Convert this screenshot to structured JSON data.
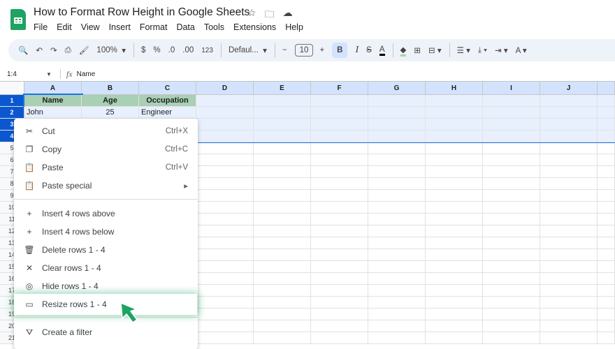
{
  "doc_title": "How to Format Row Height in Google Sheets",
  "menus": [
    "File",
    "Edit",
    "View",
    "Insert",
    "Format",
    "Data",
    "Tools",
    "Extensions",
    "Help"
  ],
  "toolbar": {
    "zoom": "100%",
    "currency": "$",
    "percent": "%",
    "dec_decrease": ".0",
    "dec_increase": ".00",
    "number_format": "123",
    "font": "Defaul...",
    "font_size": "10",
    "bold": "B",
    "italic": "I",
    "text_color": "A"
  },
  "name_box": "1:4",
  "formula_label": "fx",
  "formula": "Name",
  "columns": [
    "A",
    "B",
    "C",
    "D",
    "E",
    "F",
    "G",
    "H",
    "I",
    "J",
    ""
  ],
  "row_numbers": [
    "1",
    "2",
    "3",
    "4",
    "5",
    "6",
    "7",
    "8",
    "9",
    "10",
    "11",
    "12",
    "13",
    "14",
    "15",
    "16",
    "17",
    "18",
    "19",
    "20",
    "21"
  ],
  "cells": [
    [
      "Name",
      "Age",
      "Occupation"
    ],
    [
      "John",
      "25",
      "Engineer"
    ]
  ],
  "context_menu": [
    {
      "label": "Cut",
      "shortcut": "Ctrl+X",
      "icon": "✂",
      "name": "cut"
    },
    {
      "label": "Copy",
      "shortcut": "Ctrl+C",
      "icon": "❐",
      "name": "copy"
    },
    {
      "label": "Paste",
      "shortcut": "Ctrl+V",
      "icon": "📋",
      "name": "paste"
    },
    {
      "label": "Paste special",
      "shortcut": "▸",
      "icon": "📋",
      "name": "paste-special"
    },
    {
      "label": "Insert 4 rows above",
      "shortcut": "",
      "icon": "+",
      "name": "insert-rows-above"
    },
    {
      "label": "Insert 4 rows below",
      "shortcut": "",
      "icon": "+",
      "name": "insert-rows-below"
    },
    {
      "label": "Delete rows 1 - 4",
      "shortcut": "",
      "icon": "🗑",
      "name": "delete-rows"
    },
    {
      "label": "Clear rows 1 - 4",
      "shortcut": "",
      "icon": "✕",
      "name": "clear-rows"
    },
    {
      "label": "Hide rows 1 - 4",
      "shortcut": "",
      "icon": "◎",
      "name": "hide-rows"
    },
    {
      "label": "Resize rows 1 - 4",
      "shortcut": "",
      "icon": "▭",
      "name": "resize-rows"
    },
    {
      "label": "Create a filter",
      "shortcut": "",
      "icon": "⛛",
      "name": "create-filter"
    }
  ],
  "colors": {
    "accent": "#0b57d0",
    "header_fill": "#a9cfb5",
    "arrow": "#1ea362"
  }
}
